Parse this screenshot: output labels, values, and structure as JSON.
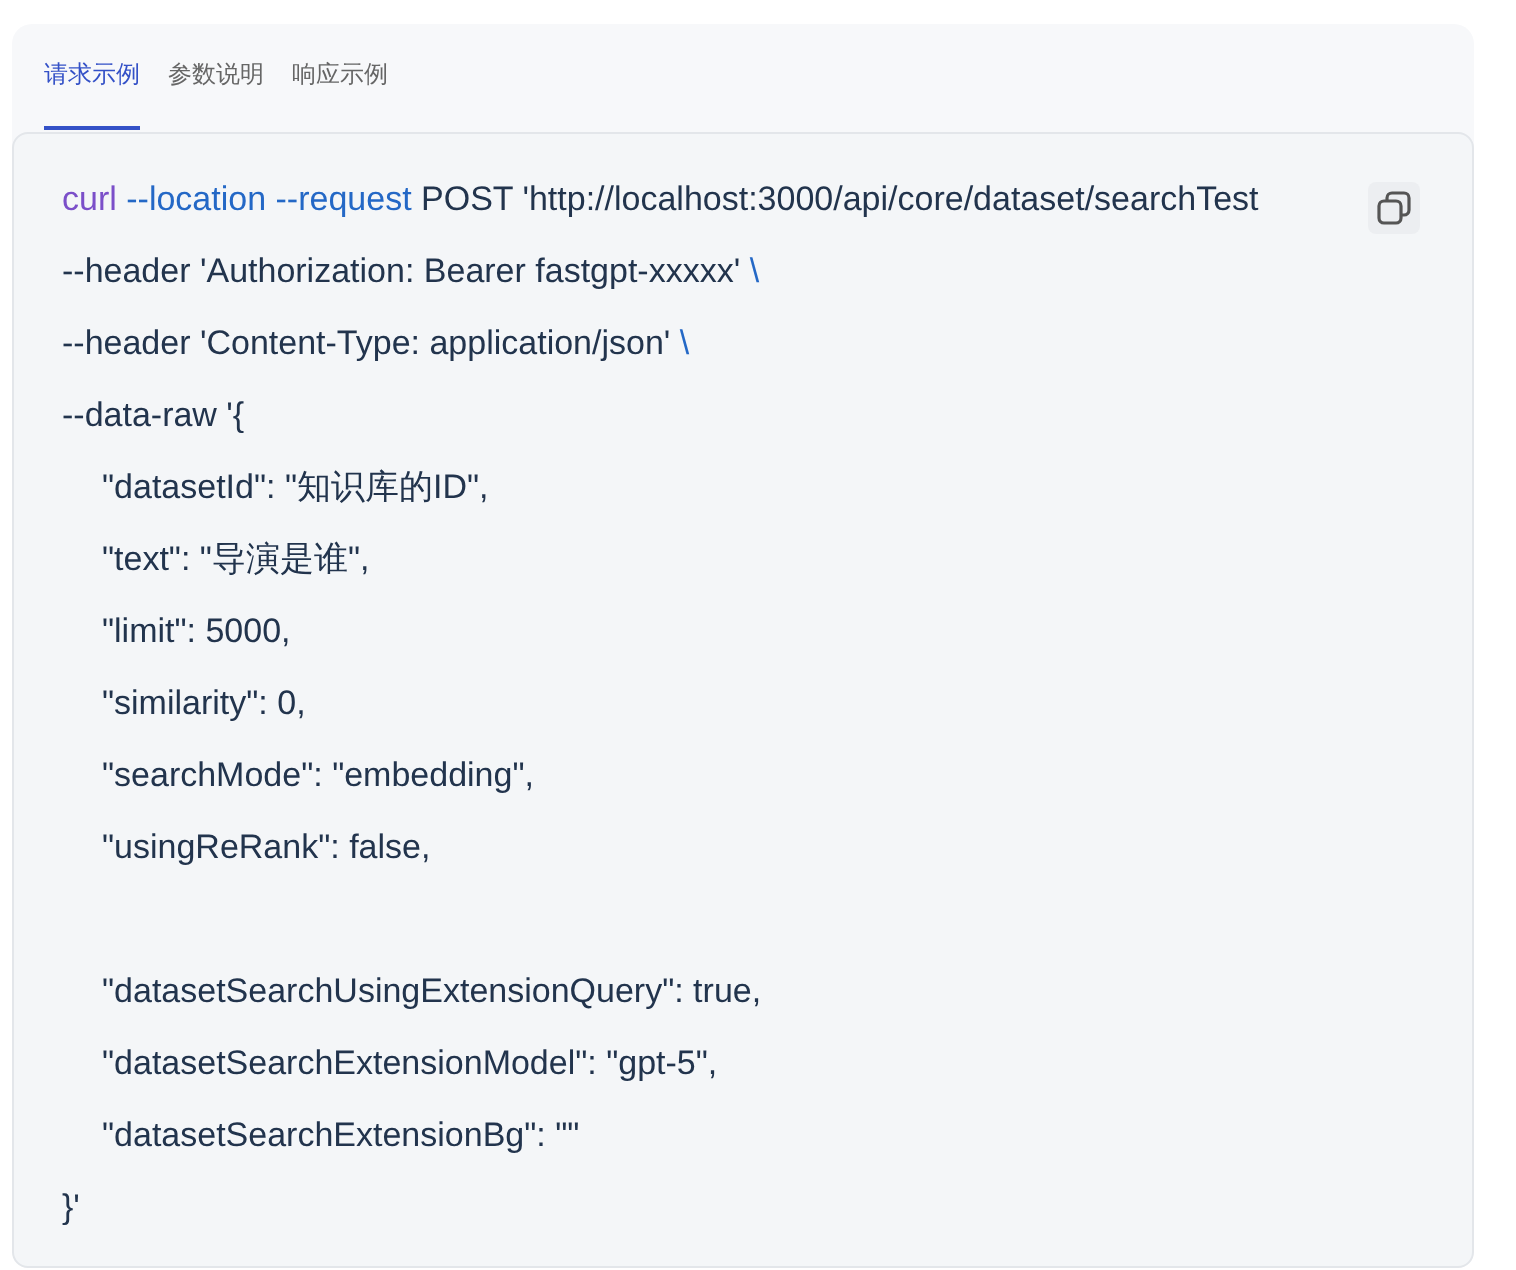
{
  "tabs": [
    {
      "label": "请求示例",
      "selected": true
    },
    {
      "label": "参数说明",
      "selected": false
    },
    {
      "label": "响应示例",
      "selected": false
    }
  ],
  "code_lines": [
    {
      "segments": [
        {
          "kind": "command",
          "text": "curl"
        },
        {
          "kind": "flag",
          "text": " --location --request"
        },
        {
          "kind": "plain",
          "text": " POST 'http://localhost:3000/api/core/dataset/searchTest"
        }
      ]
    },
    {
      "segments": [
        {
          "kind": "plain",
          "text": "--header 'Authorization: Bearer fastgpt-xxxxx' "
        },
        {
          "kind": "flag",
          "text": "\\"
        }
      ]
    },
    {
      "segments": [
        {
          "kind": "plain",
          "text": "--header 'Content-Type: application/json' "
        },
        {
          "kind": "flag",
          "text": "\\"
        }
      ]
    },
    {
      "segments": [
        {
          "kind": "plain",
          "text": "--data-raw '{"
        }
      ],
      "children": [
        {
          "lines": [
            "\"datasetId\": \"知识库的ID\",",
            "\"text\": \"导演是谁\",",
            "\"limit\": 5000,",
            "\"similarity\": 0,",
            "\"searchMode\": \"embedding\",",
            "\"usingReRank\": false,"
          ]
        },
        {
          "lines": [
            "\"datasetSearchUsingExtensionQuery\": true,",
            "\"datasetSearchExtensionModel\": \"gpt-5\",",
            "\"datasetSearchExtensionBg\": \"\""
          ]
        }
      ]
    },
    {
      "segments": [
        {
          "kind": "plain",
          "text": "}'"
        }
      ]
    }
  ]
}
